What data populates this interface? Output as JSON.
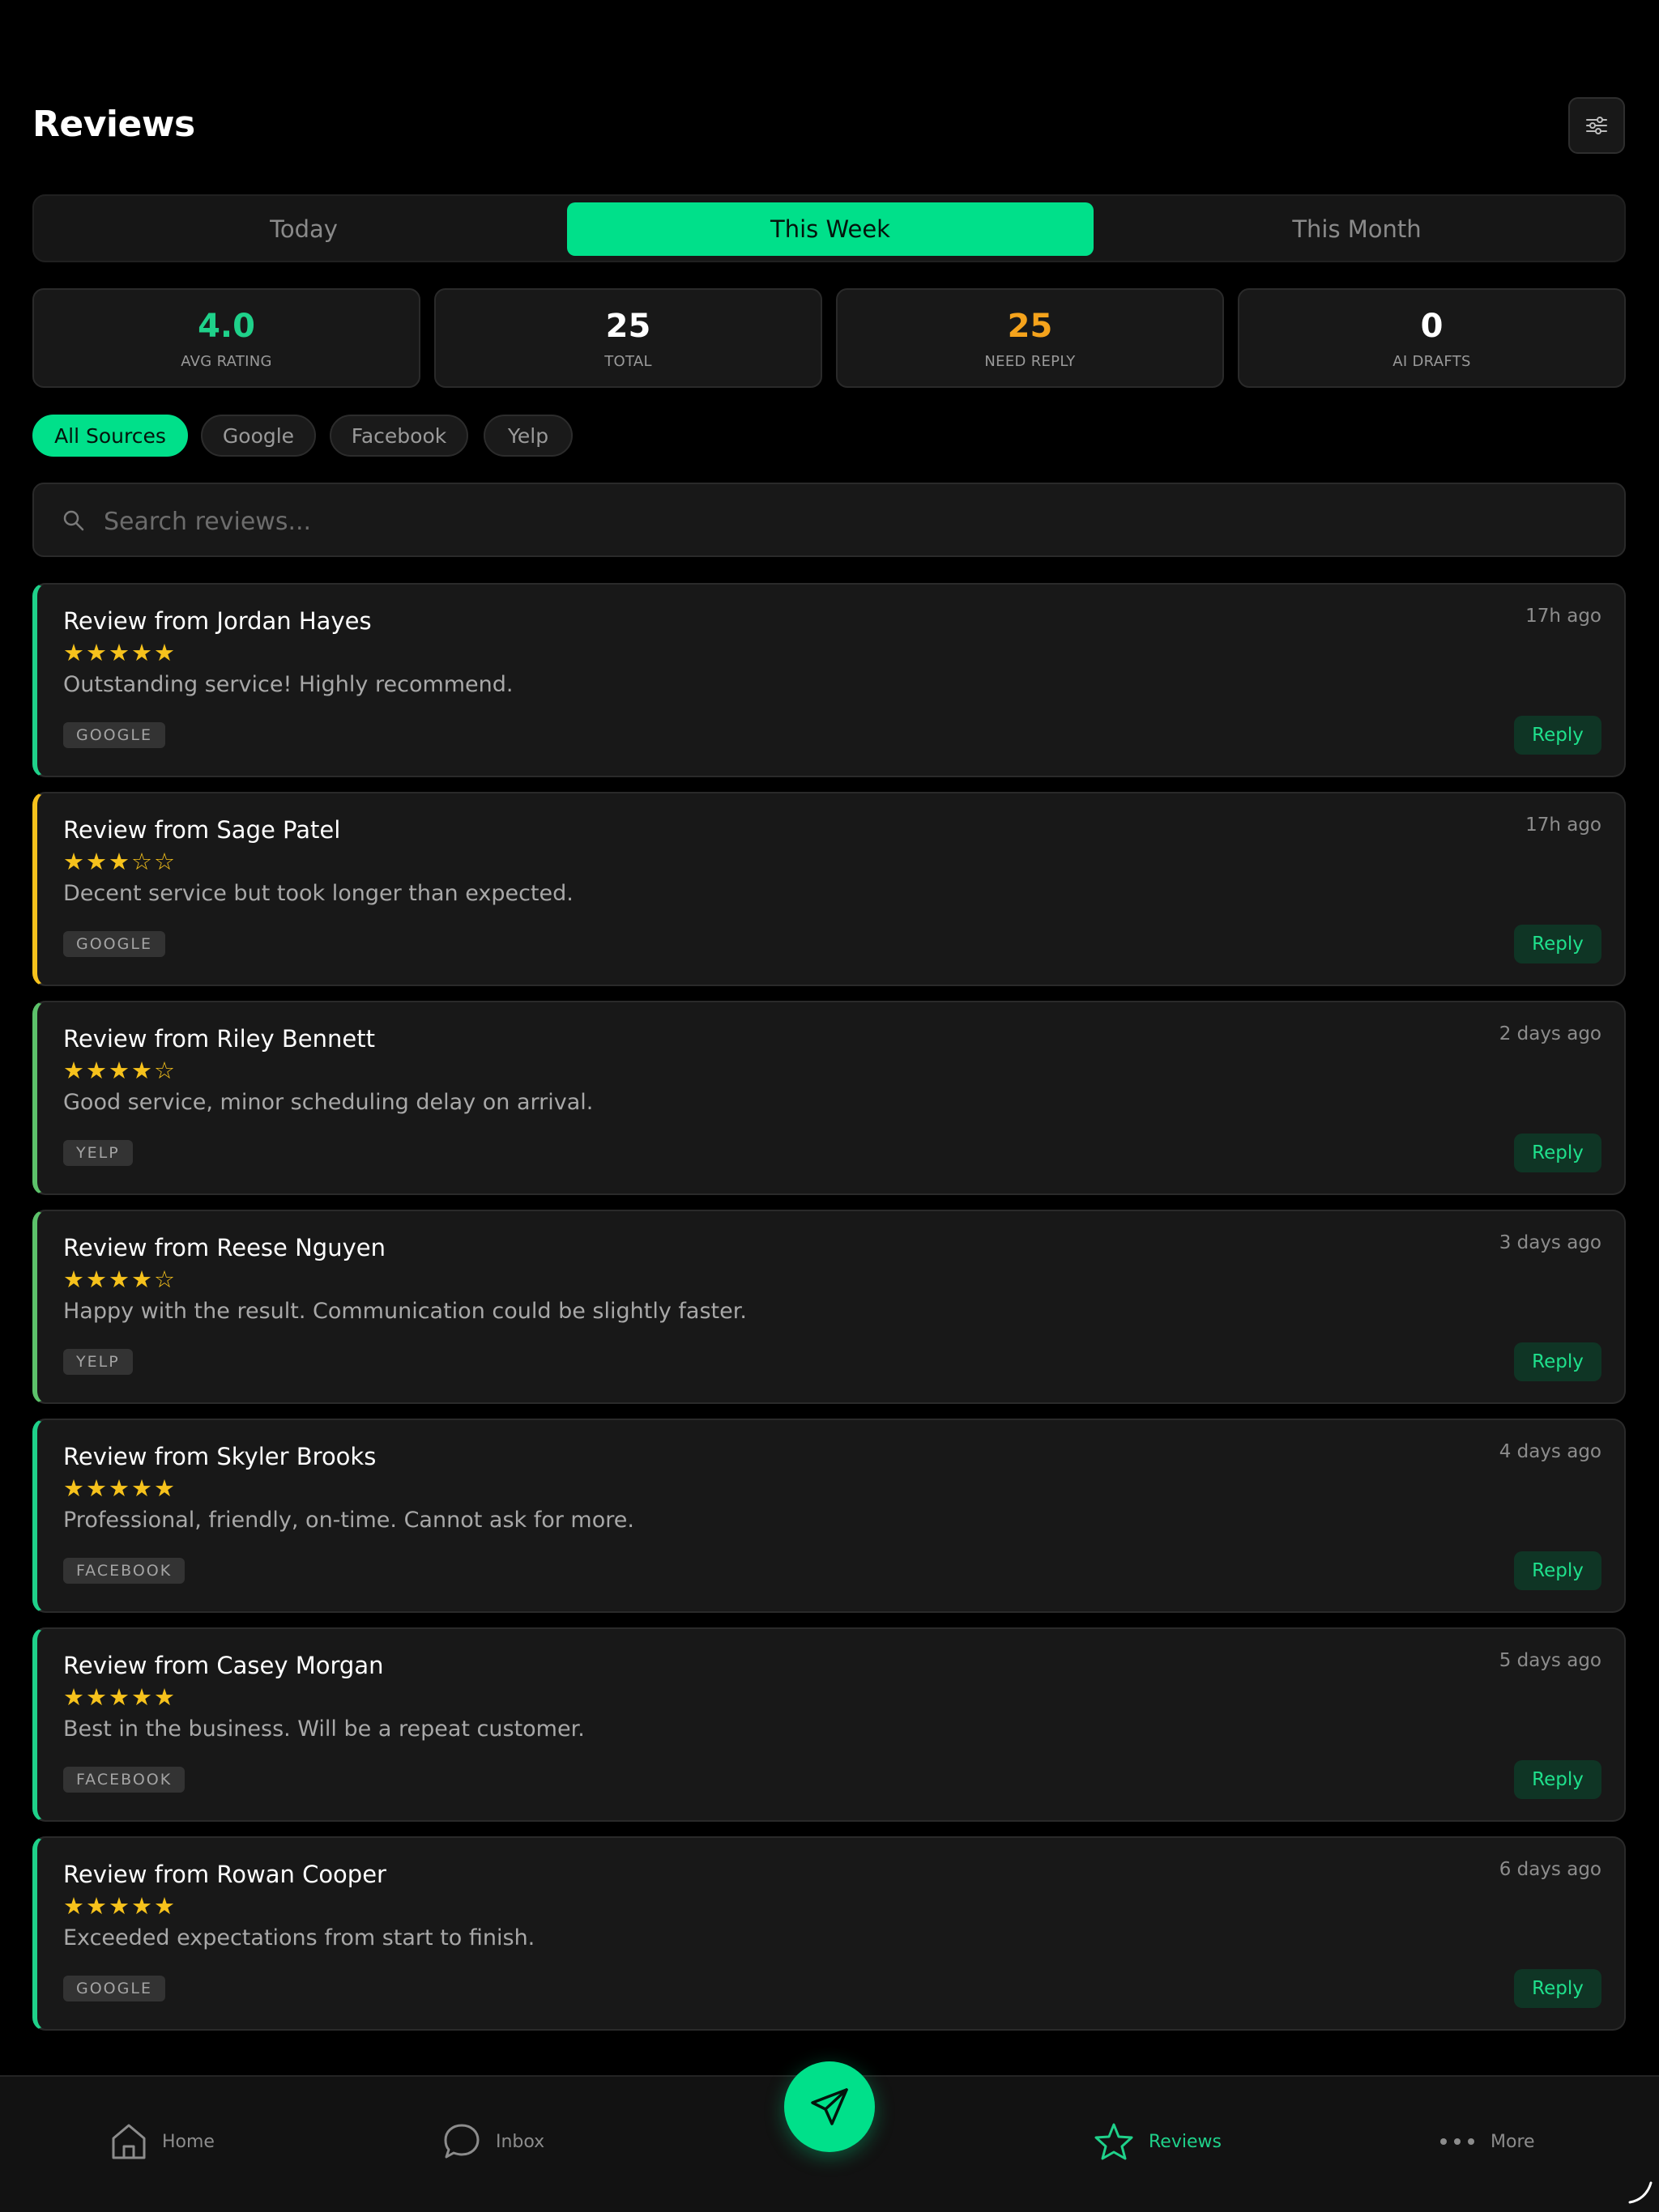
{
  "header": {
    "title": "Reviews",
    "settings_icon": "sliders-icon"
  },
  "period_tabs": {
    "selected": "This Week",
    "items": [
      {
        "label": "Today"
      },
      {
        "label": "This Week"
      },
      {
        "label": "This Month"
      }
    ]
  },
  "stats": [
    {
      "value": "4.0",
      "label": "AVG RATING",
      "color": "#1fd18a"
    },
    {
      "value": "25",
      "label": "TOTAL",
      "color": "#ffffff"
    },
    {
      "value": "25",
      "label": "NEED REPLY",
      "color": "#f5a31c"
    },
    {
      "value": "0",
      "label": "AI DRAFTS",
      "color": "#ffffff"
    }
  ],
  "source_filters": {
    "selected": "All Sources",
    "items": [
      {
        "label": "All Sources"
      },
      {
        "label": "Google"
      },
      {
        "label": "Facebook"
      },
      {
        "label": "Yelp"
      }
    ]
  },
  "search": {
    "placeholder": "Search reviews...",
    "value": ""
  },
  "reviews": [
    {
      "title": "Review from Jordan Hayes",
      "rating": 5,
      "stars": "★★★★★",
      "text": "Outstanding service! Highly recommend.",
      "source": "GOOGLE",
      "time": "17h ago",
      "accent": "#1fd18a",
      "reply_label": "Reply"
    },
    {
      "title": "Review from Sage Patel",
      "rating": 3,
      "stars": "★★★☆☆",
      "text": "Decent service but took longer than expected.",
      "source": "GOOGLE",
      "time": "17h ago",
      "accent": "#f6c21c",
      "reply_label": "Reply"
    },
    {
      "title": "Review from Riley Bennett",
      "rating": 4,
      "stars": "★★★★☆",
      "text": "Good service, minor scheduling delay on arrival.",
      "source": "YELP",
      "time": "2 days ago",
      "accent": "#5cc26a",
      "reply_label": "Reply"
    },
    {
      "title": "Review from Reese Nguyen",
      "rating": 4,
      "stars": "★★★★☆",
      "text": "Happy with the result. Communication could be slightly faster.",
      "source": "YELP",
      "time": "3 days ago",
      "accent": "#5cc26a",
      "reply_label": "Reply"
    },
    {
      "title": "Review from Skyler Brooks",
      "rating": 5,
      "stars": "★★★★★",
      "text": "Professional, friendly, on-time. Cannot ask for more.",
      "source": "FACEBOOK",
      "time": "4 days ago",
      "accent": "#1fd18a",
      "reply_label": "Reply"
    },
    {
      "title": "Review from Casey Morgan",
      "rating": 5,
      "stars": "★★★★★",
      "text": "Best in the business. Will be a repeat customer.",
      "source": "FACEBOOK",
      "time": "5 days ago",
      "accent": "#1fd18a",
      "reply_label": "Reply"
    },
    {
      "title": "Review from Rowan Cooper",
      "rating": 5,
      "stars": "★★★★★",
      "text": "Exceeded expectations from start to finish.",
      "source": "GOOGLE",
      "time": "6 days ago",
      "accent": "#1fd18a",
      "reply_label": "Reply"
    }
  ],
  "bottom_nav": {
    "selected": "Reviews",
    "items": [
      {
        "label": "Home",
        "icon": "home-icon"
      },
      {
        "label": "Inbox",
        "icon": "chat-bubble-icon"
      },
      {
        "label": "Reviews",
        "icon": "star-icon"
      },
      {
        "label": "More",
        "icon": "more-dots-icon"
      }
    ],
    "fab_icon": "send-icon"
  },
  "colors": {
    "accent": "#00e08a",
    "background": "#000000",
    "card": "#181818",
    "star": "#f6c21c",
    "warning": "#f5a31c"
  }
}
